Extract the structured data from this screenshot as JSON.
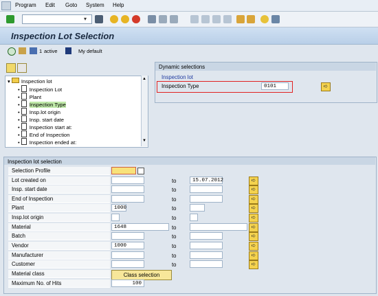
{
  "menu": {
    "items": [
      "Program",
      "Edit",
      "Goto",
      "System",
      "Help"
    ]
  },
  "title": "Inspection Lot Selection",
  "apptoolbar": {
    "active_count": "1",
    "active_label": "active",
    "my_default_label": "My default"
  },
  "tree": {
    "root": "Inspection lot",
    "items": [
      "Inspection Lot",
      "Plant",
      "Inspection Type",
      "Insp.lot origin",
      "Insp. start date",
      "Inspection start at:",
      "End of Inspection",
      "Inspection ended at:"
    ]
  },
  "dynamic": {
    "header": "Dynamic selections",
    "group": "Inspection lot",
    "field_label": "Inspection Type",
    "field_value": "0101"
  },
  "selection": {
    "header": "Inspection lot selection",
    "rows": [
      {
        "label": "Selection Profile",
        "from": "",
        "to": null
      },
      {
        "label": "Lot created on",
        "from": "",
        "to": "15.07.2012"
      },
      {
        "label": "Insp. start date",
        "from": "",
        "to": ""
      },
      {
        "label": "End of Inspection",
        "from": "",
        "to": ""
      },
      {
        "label": "Plant",
        "from": "1000",
        "to": ""
      },
      {
        "label": "Insp.lot origin",
        "from": "",
        "to": ""
      },
      {
        "label": "Material",
        "from": "1648",
        "to": ""
      },
      {
        "label": "Batch",
        "from": "",
        "to": ""
      },
      {
        "label": "Vendor",
        "from": "1000",
        "to": ""
      },
      {
        "label": "Manufacturer",
        "from": "",
        "to": ""
      },
      {
        "label": "Customer",
        "from": "",
        "to": ""
      },
      {
        "label": "Material class",
        "from": null,
        "to": null
      },
      {
        "label": "Maximum No. of Hits",
        "from": "100",
        "to": null
      }
    ],
    "to_label": "to",
    "class_button": "Class selection"
  },
  "colors": {
    "title_bg": "#c7dbef",
    "highlight": "#e02020",
    "button_yellow": "#f4d24e"
  }
}
